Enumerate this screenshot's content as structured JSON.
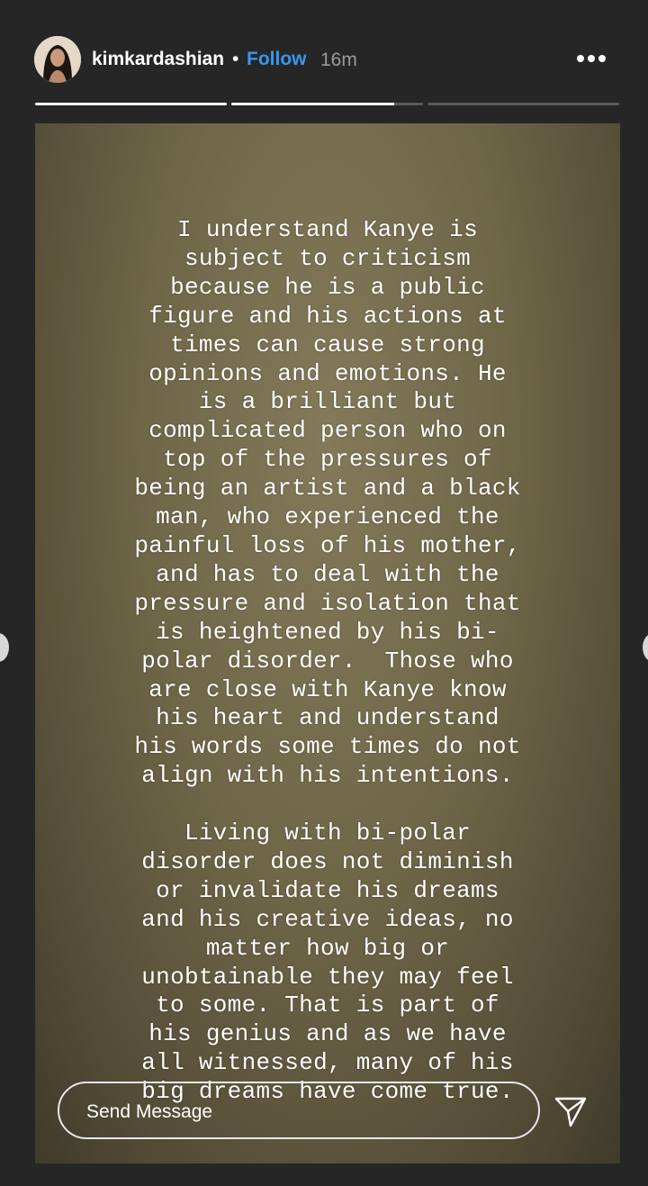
{
  "header": {
    "username": "kimkardashian",
    "separator": "•",
    "follow_label": "Follow",
    "time": "16m"
  },
  "progress": {
    "segments": [
      1.0,
      0.85,
      0.0
    ]
  },
  "story": {
    "lines": [
      "I understand Kanye is",
      "subject to criticism",
      "because he is a public",
      "figure and his actions at",
      "times can cause strong",
      "opinions and emotions. He",
      "is a brilliant but",
      "complicated person who on",
      "top of the pressures of",
      "being an artist and a black",
      "man, who experienced the",
      "painful loss of his mother,",
      "and has to deal with the",
      "pressure and isolation that",
      "is heightened by his bi-",
      "polar disorder.  Those who",
      "are close with Kanye know",
      "his heart and understand",
      "his words some times do not",
      "align with his intentions.",
      "",
      "Living with bi-polar",
      "disorder does not diminish",
      "or invalidate his dreams",
      "and his creative ideas, no",
      "matter how big or",
      "unobtainable they may feel",
      "to some. That is part of",
      "his genius and as we have",
      "all witnessed, many of his",
      "big dreams have come true."
    ]
  },
  "message": {
    "placeholder": "Send Message"
  },
  "icons": {
    "more": "more-options-icon",
    "send": "paper-plane-icon",
    "avatar": "profile-photo"
  }
}
